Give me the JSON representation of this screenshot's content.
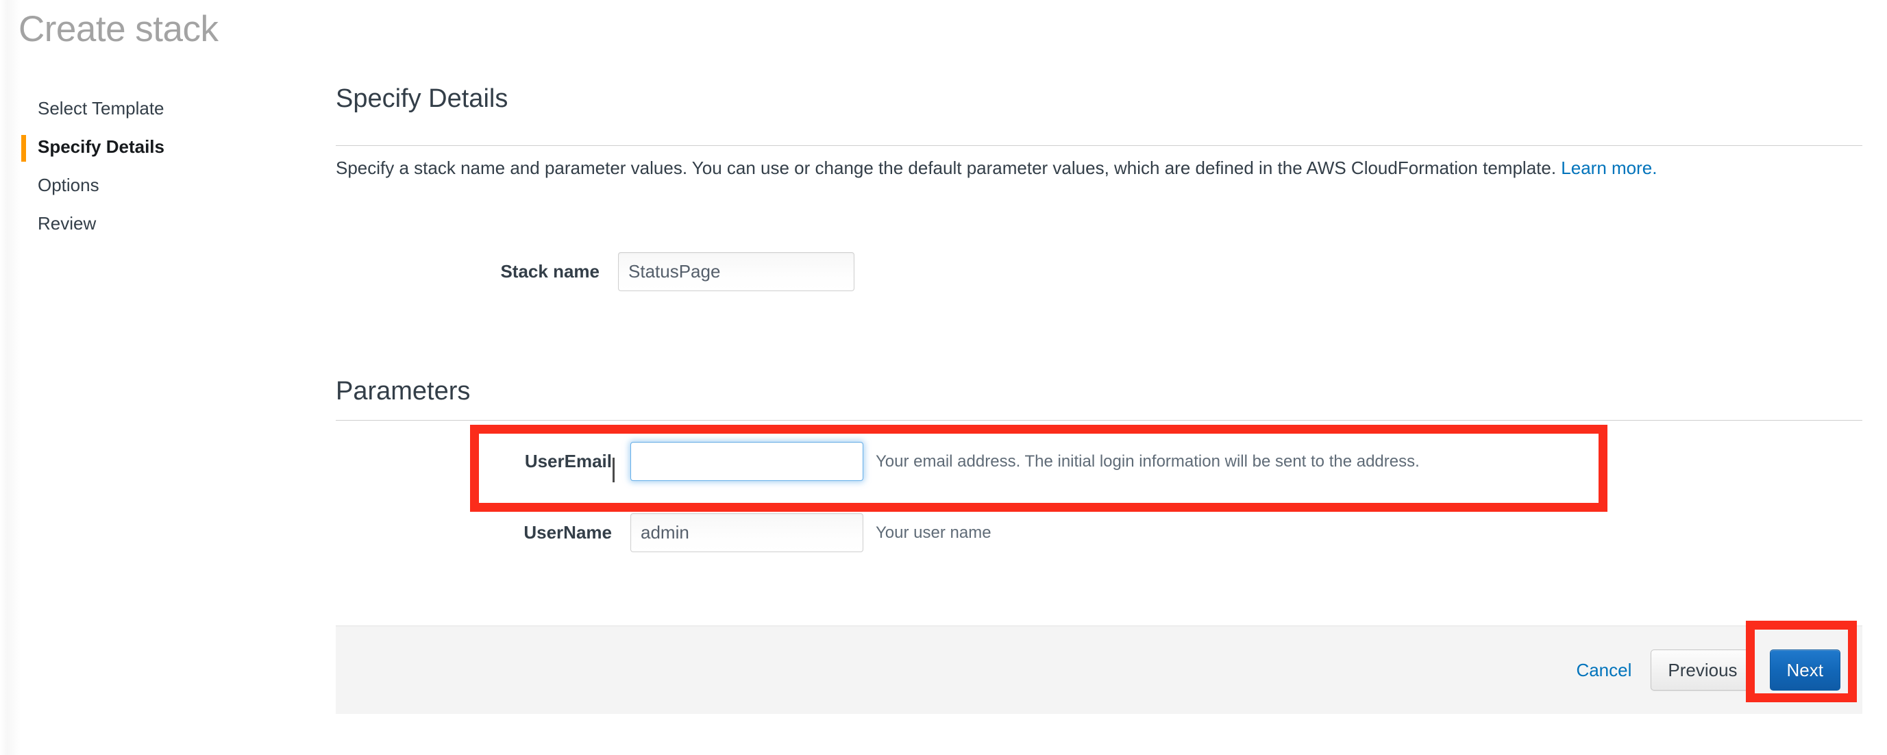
{
  "page": {
    "title": "Create stack"
  },
  "wizard": {
    "items": [
      {
        "label": "Select Template",
        "active": false
      },
      {
        "label": "Specify Details",
        "active": true
      },
      {
        "label": "Options",
        "active": false
      },
      {
        "label": "Review",
        "active": false
      }
    ]
  },
  "details": {
    "heading": "Specify Details",
    "intro_text": "Specify a stack name and parameter values. You can use or change the default parameter values, which are defined in the AWS CloudFormation template. ",
    "learn_more_label": "Learn more.",
    "stack_name": {
      "label": "Stack name",
      "value": "StatusPage",
      "placeholder": ""
    }
  },
  "parameters": {
    "heading": "Parameters",
    "rows": [
      {
        "label": "UserEmail",
        "value": "",
        "placeholder": "",
        "help": "Your email address. The initial login information will be sent to the address.",
        "focused": true,
        "highlighted": true
      },
      {
        "label": "UserName",
        "value": "admin",
        "placeholder": "",
        "help": "Your user name",
        "focused": false,
        "highlighted": false
      }
    ]
  },
  "footer": {
    "cancel_label": "Cancel",
    "previous_label": "Previous",
    "next_label": "Next"
  },
  "colors": {
    "accent_orange": "#ff9900",
    "link_blue": "#0073bb",
    "primary_button_blue": "#1267b8",
    "highlight_red": "#fb2c1b",
    "focus_blue": "#66afe9",
    "title_gray": "#a3a3a3"
  }
}
